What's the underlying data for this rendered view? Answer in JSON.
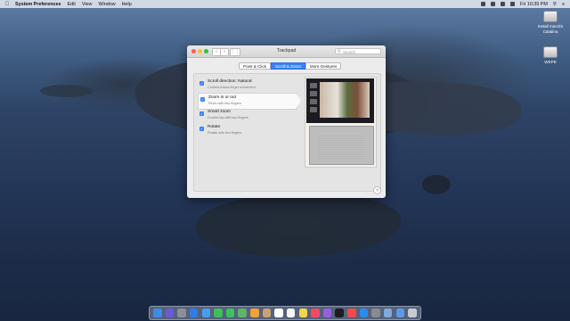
{
  "menubar": {
    "app_name": "System Preferences",
    "items": [
      "Edit",
      "View",
      "Window",
      "Help"
    ],
    "clock": "Fri 10:39 PM"
  },
  "desktop_icons": [
    {
      "label_line1": "Install macOS",
      "label_line2": "Catalina",
      "icon": "disk-image-icon"
    },
    {
      "label_line1": "WEPE",
      "label_line2": "",
      "icon": "external-drive-icon"
    }
  ],
  "window": {
    "title": "Trackpad",
    "search_placeholder": "Search",
    "tabs": [
      {
        "label": "Point & Click",
        "active": false
      },
      {
        "label": "Scroll & Zoom",
        "active": true
      },
      {
        "label": "More Gestures",
        "active": false
      }
    ],
    "options": [
      {
        "title": "Scroll direction: Natural",
        "desc": "Content tracks finger movement",
        "checked": true,
        "selected": false
      },
      {
        "title": "Zoom in or out",
        "desc": "Pinch with two fingers",
        "checked": true,
        "selected": true
      },
      {
        "title": "Smart zoom",
        "desc": "Double-tap with two fingers",
        "checked": true,
        "selected": false
      },
      {
        "title": "Rotate",
        "desc": "Rotate with two fingers",
        "checked": true,
        "selected": false
      }
    ],
    "help_label": "?"
  },
  "dock": {
    "icons": [
      "finder-icon",
      "siri-icon",
      "launchpad-icon",
      "safari-icon",
      "mail-icon",
      "facetime-icon",
      "messages-icon",
      "maps-icon",
      "photos-icon",
      "contacts-icon",
      "calendar-icon",
      "reminders-icon",
      "notes-icon",
      "music-icon",
      "podcasts-icon",
      "tv-icon",
      "news-icon",
      "app-store-icon",
      "system-preferences-icon",
      "finder-window-icon",
      "downloads-icon",
      "trash-icon"
    ],
    "colors": [
      "#3d8de8",
      "#6a5cd8",
      "#8a8f99",
      "#2f7de6",
      "#4a9cf0",
      "#3fbf5a",
      "#3cc45c",
      "#5fb36a",
      "#f0a23c",
      "#c9a27a",
      "#ffffff",
      "#f5f5f5",
      "#f3d44a",
      "#f34a63",
      "#9a5ce0",
      "#1c1c1e",
      "#f14a4a",
      "#2a8cf0",
      "#8a8a90",
      "#7fa9d8",
      "#5b9ae6",
      "#c8ccd2"
    ]
  }
}
